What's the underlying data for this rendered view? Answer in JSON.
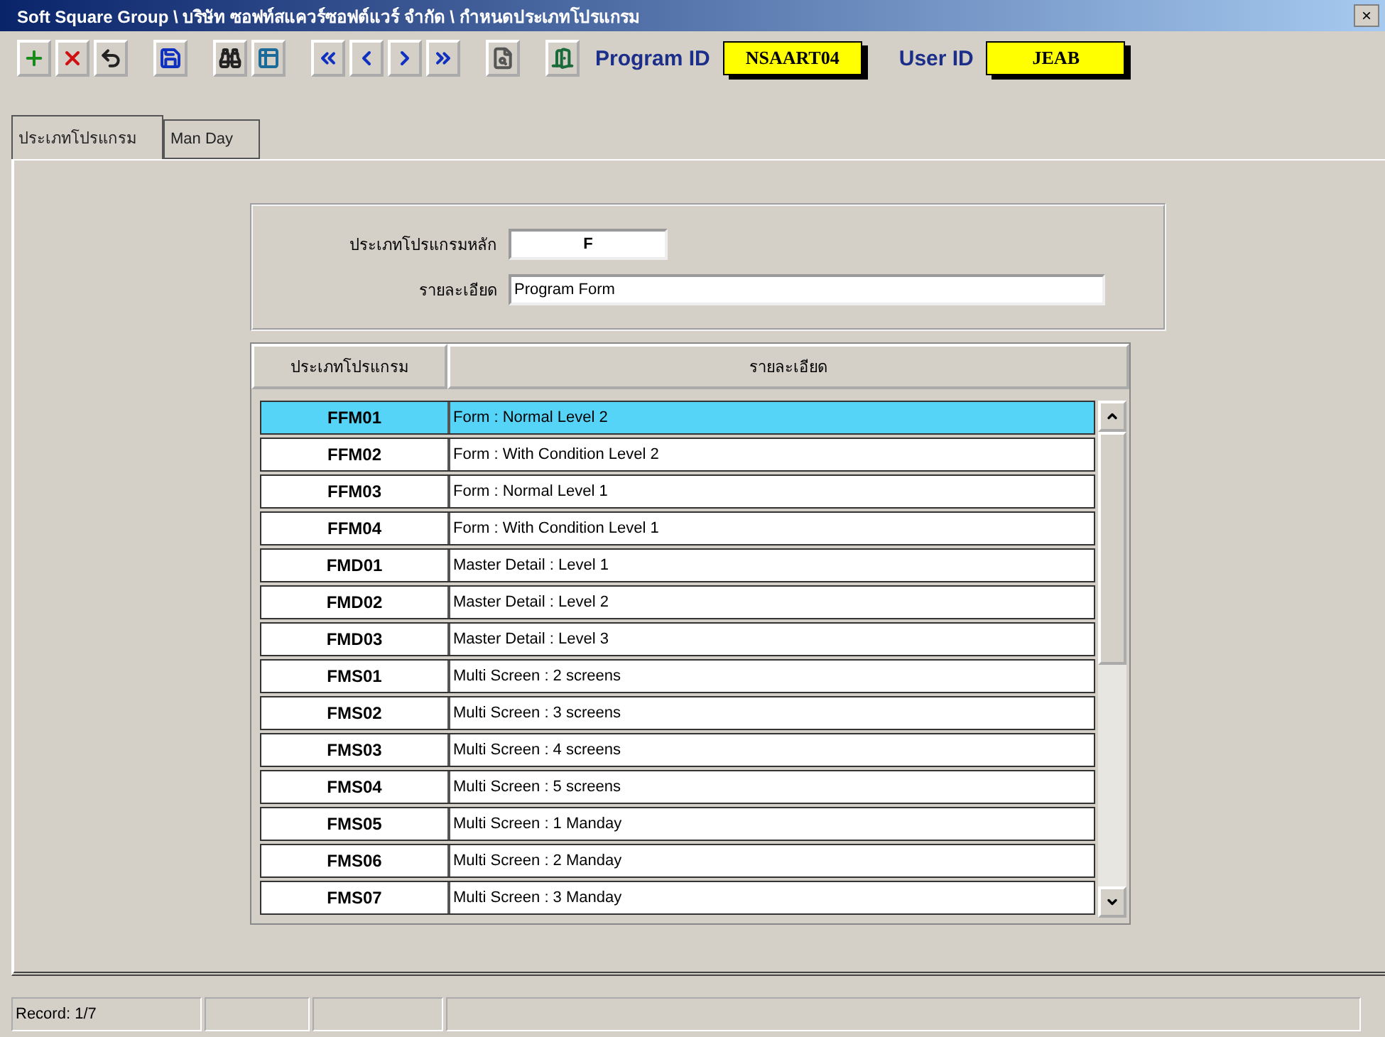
{
  "window": {
    "title": "Soft Square Group \\ บริษัท ซอฟท์สแควร์ซอฟต์แวร์ จำกัด \\ กำหนดประเภทโปรแกรม",
    "close": "×"
  },
  "toolbar": {
    "program_id_label": "Program ID",
    "program_id": "NSAART04",
    "user_id_label": "User ID",
    "user_id": "JEAB"
  },
  "tabs": [
    {
      "label": "ประเภทโปรแกรม",
      "selected": true
    },
    {
      "label": "Man Day",
      "selected": false
    }
  ],
  "form": {
    "main_type_label": "ประเภทโปรแกรมหลัก",
    "main_type": "F",
    "detail_label": "รายละเอียด",
    "detail": "Program Form"
  },
  "table": {
    "columns": [
      "ประเภทโปรแกรม",
      "รายละเอียด"
    ],
    "rows": [
      {
        "code": "FFM01",
        "detail": "Form : Normal Level 2",
        "selected": true
      },
      {
        "code": "FFM02",
        "detail": "Form : With Condition Level 2",
        "selected": false
      },
      {
        "code": "FFM03",
        "detail": "Form : Normal Level 1",
        "selected": false
      },
      {
        "code": "FFM04",
        "detail": "Form : With Condition Level 1",
        "selected": false
      },
      {
        "code": "FMD01",
        "detail": "Master Detail : Level 1",
        "selected": false
      },
      {
        "code": "FMD02",
        "detail": "Master Detail : Level 2",
        "selected": false
      },
      {
        "code": "FMD03",
        "detail": "Master Detail : Level 3",
        "selected": false
      },
      {
        "code": "FMS01",
        "detail": "Multi Screen : 2 screens",
        "selected": false
      },
      {
        "code": "FMS02",
        "detail": "Multi Screen : 3 screens",
        "selected": false
      },
      {
        "code": "FMS03",
        "detail": "Multi Screen : 4 screens",
        "selected": false
      },
      {
        "code": "FMS04",
        "detail": "Multi Screen : 5 screens",
        "selected": false
      },
      {
        "code": "FMS05",
        "detail": "Multi Screen : 1 Manday",
        "selected": false
      },
      {
        "code": "FMS06",
        "detail": "Multi Screen : 2 Manday",
        "selected": false
      },
      {
        "code": "FMS07",
        "detail": "Multi Screen : 3 Manday",
        "selected": false
      }
    ]
  },
  "status_bar": {
    "record": "Record: 1/7"
  }
}
